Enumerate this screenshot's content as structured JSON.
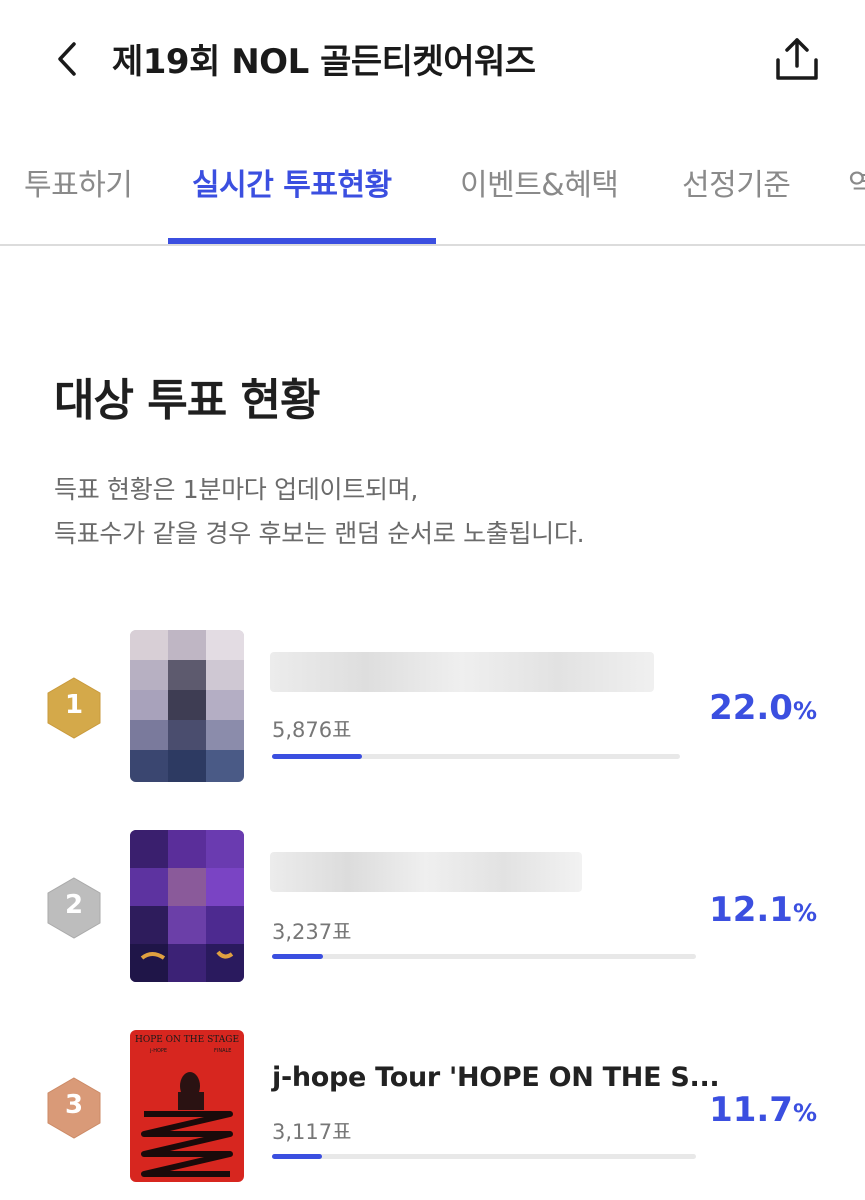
{
  "header": {
    "title": "제19회 NOL 골든티켓어워즈",
    "back_icon": "chevron-left-icon",
    "share_icon": "share-icon"
  },
  "tabs": [
    {
      "label": "투표하기",
      "active": false
    },
    {
      "label": "실시간 투표현황",
      "active": true
    },
    {
      "label": "이벤트&혜택",
      "active": false
    },
    {
      "label": "선정기준",
      "active": false
    },
    {
      "label": "역",
      "active": false
    }
  ],
  "section": {
    "title": "대상 투표 현황",
    "desc_line1": "득표 현황은 1분마다 업데이트되며,",
    "desc_line2": "득표수가 같을 경우 후보는 랜덤 순서로 노출됩니다."
  },
  "rankings": [
    {
      "rank": "1",
      "title": "",
      "votes": "5,876표",
      "percent": "22.0",
      "unit": "%",
      "share": 0.22,
      "badge_color": "#d4a94a"
    },
    {
      "rank": "2",
      "title": "",
      "votes": "3,237표",
      "percent": "12.1",
      "unit": "%",
      "share": 0.121,
      "badge_color": "#bdbdbd"
    },
    {
      "rank": "3",
      "title": "j-hope Tour 'HOPE ON THE S...",
      "votes": "3,117표",
      "percent": "11.7",
      "unit": "%",
      "share": 0.117,
      "badge_color": "#d99a78"
    }
  ],
  "thumb3": {
    "line1": "HOPE ON THE STAGE",
    "line2": "j-HOPE",
    "line3": "FINALE"
  },
  "colors": {
    "accent": "#3b4fe0",
    "gold": "#d4a94a",
    "silver": "#bdbdbd",
    "bronze": "#d99a78"
  }
}
